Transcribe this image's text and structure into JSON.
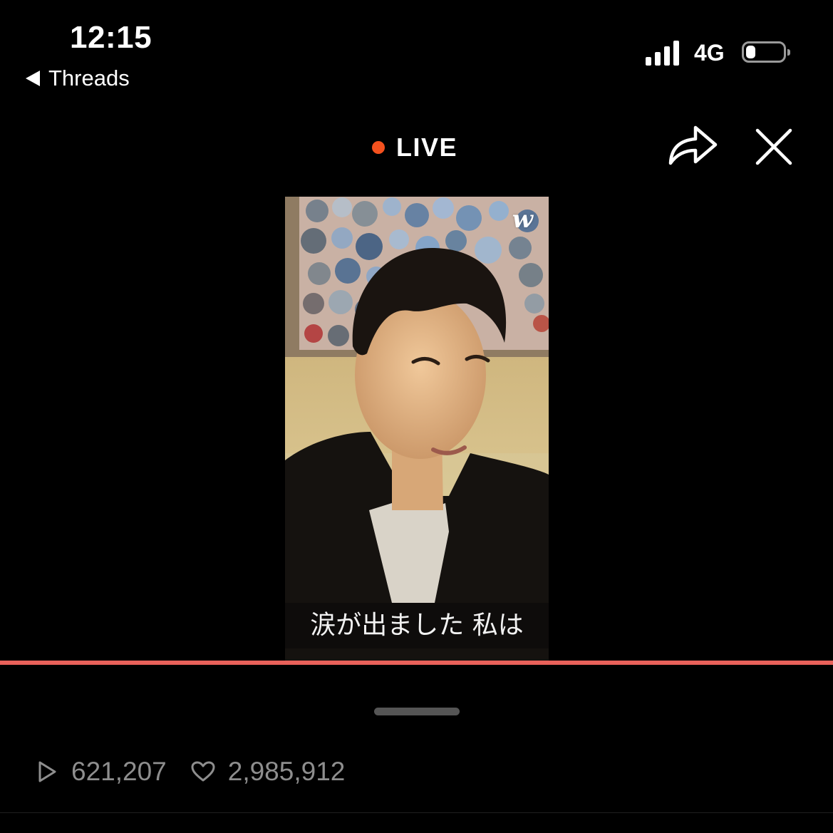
{
  "status_bar": {
    "time": "12:15",
    "back_label": "Threads",
    "network": "4G",
    "battery_level": 0.25,
    "signal_bars": 4
  },
  "header": {
    "live_label": "LIVE",
    "live_dot_color": "#f4511e"
  },
  "video": {
    "brand_mark": "w",
    "caption": "涙が出ました 私は"
  },
  "stats": {
    "plays": "621,207",
    "likes": "2,985,912"
  },
  "colors": {
    "background": "#000000",
    "progress": "#e8615a",
    "stat_text": "#8e8e8e"
  }
}
